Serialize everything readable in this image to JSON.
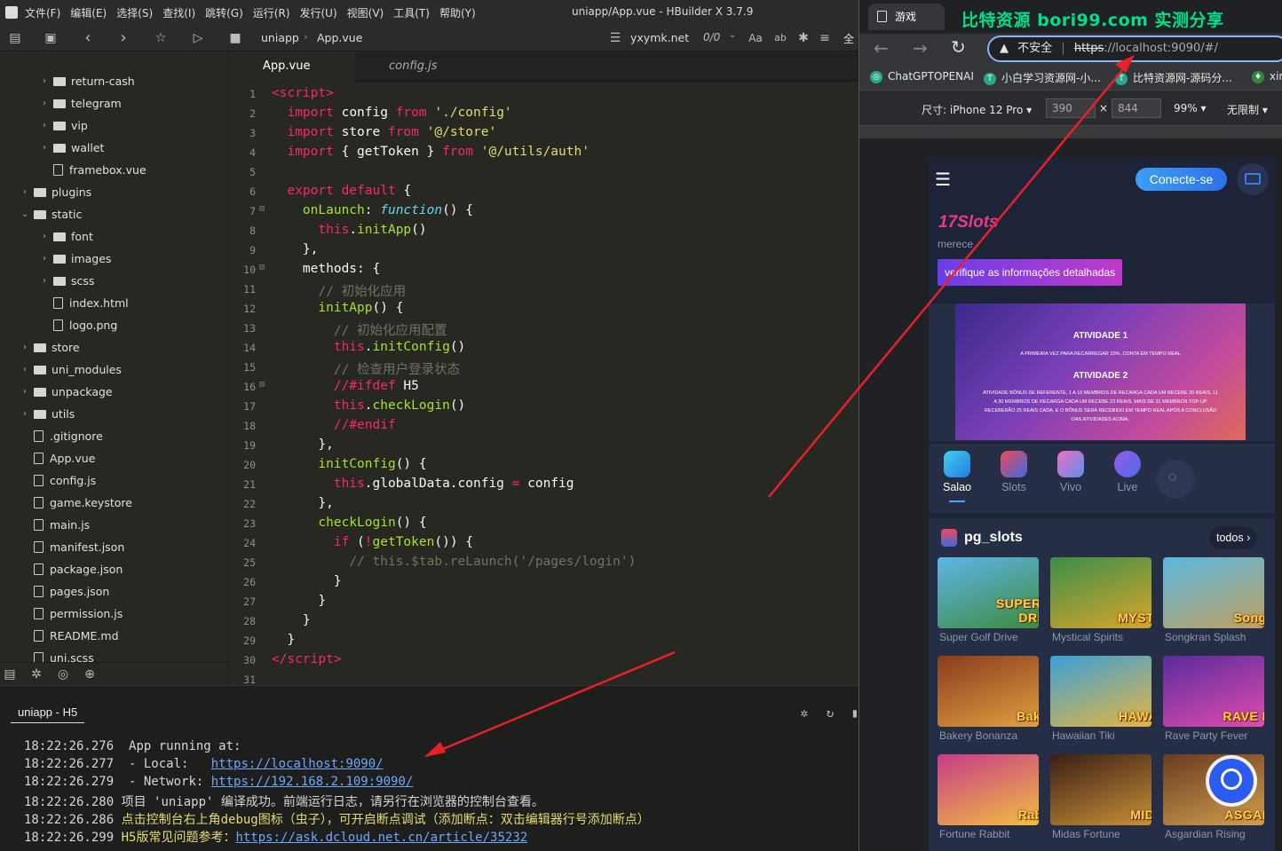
{
  "ide": {
    "menu": [
      "文件(F)",
      "编辑(E)",
      "选择(S)",
      "查找(I)",
      "跳转(G)",
      "运行(R)",
      "发行(U)",
      "视图(V)",
      "工具(T)",
      "帮助(Y)"
    ],
    "window_title": "uniapp/App.vue - HBuilder X 3.7.9",
    "breadcrumb": [
      "uniapp",
      "App.vue"
    ],
    "search_value": "yxymk.net",
    "match_count": "0/0",
    "toolbar_trailing": "全",
    "tree": [
      {
        "label": "return-cash",
        "type": "folder",
        "depth": 2
      },
      {
        "label": "telegram",
        "type": "folder",
        "depth": 2
      },
      {
        "label": "vip",
        "type": "folder",
        "depth": 2
      },
      {
        "label": "wallet",
        "type": "folder",
        "depth": 2
      },
      {
        "label": "framebox.vue",
        "type": "file",
        "depth": 2
      },
      {
        "label": "plugins",
        "type": "folder",
        "depth": 1
      },
      {
        "label": "static",
        "type": "folder-open",
        "depth": 1
      },
      {
        "label": "font",
        "type": "folder",
        "depth": 2
      },
      {
        "label": "images",
        "type": "folder",
        "depth": 2
      },
      {
        "label": "scss",
        "type": "folder",
        "depth": 2
      },
      {
        "label": "index.html",
        "type": "file",
        "depth": 2
      },
      {
        "label": "logo.png",
        "type": "file",
        "depth": 2
      },
      {
        "label": "store",
        "type": "folder",
        "depth": 1
      },
      {
        "label": "uni_modules",
        "type": "folder",
        "depth": 1
      },
      {
        "label": "unpackage",
        "type": "folder",
        "depth": 1
      },
      {
        "label": "utils",
        "type": "folder",
        "depth": 1
      },
      {
        "label": ".gitignore",
        "type": "file",
        "depth": 1
      },
      {
        "label": "App.vue",
        "type": "file",
        "depth": 1
      },
      {
        "label": "config.js",
        "type": "file",
        "depth": 1
      },
      {
        "label": "game.keystore",
        "type": "file",
        "depth": 1
      },
      {
        "label": "main.js",
        "type": "file",
        "depth": 1
      },
      {
        "label": "manifest.json",
        "type": "file",
        "depth": 1
      },
      {
        "label": "package.json",
        "type": "file",
        "depth": 1
      },
      {
        "label": "pages.json",
        "type": "file",
        "depth": 1
      },
      {
        "label": "permission.js",
        "type": "file",
        "depth": 1
      },
      {
        "label": "README.md",
        "type": "file",
        "depth": 1
      },
      {
        "label": "uni.scss",
        "type": "file",
        "depth": 1
      }
    ],
    "tabs": [
      "App.vue",
      "config.js"
    ],
    "console_tab": "uniapp - H5",
    "console": [
      {
        "time": "18:22:26.276",
        "text": "  App running at:"
      },
      {
        "time": "18:22:26.277",
        "text": "  - Local:   ",
        "link": "https://localhost:9090/"
      },
      {
        "time": "18:22:26.279",
        "text": "  - Network: ",
        "link": "https://192.168.2.109:9090/"
      },
      {
        "time": "18:22:26.280",
        "text": " 项目 'uniapp' 编译成功。前端运行日志，请另行在浏览器的控制台查看。"
      },
      {
        "time": "18:22:26.286",
        "text": " 点击控制台右上角debug图标（虫子），可开启断点调试（添加断点：双击编辑器行号添加断点）",
        "warn": true
      },
      {
        "time": "18:22:26.299",
        "text": " H5版常见问题参考：",
        "link": "https://ask.dcloud.net.cn/article/35232",
        "warn": true
      }
    ]
  },
  "browser": {
    "tab_title": "游戏",
    "watermark": "比特资源 bori99.com 实测分享",
    "security": "不安全",
    "url_scheme": "https",
    "url_rest": "://localhost:9090/#/",
    "bookmarks": [
      "ChatGPTOPENAI",
      "小白学习资源网-小...",
      "比特资源网-源码分...",
      "xir"
    ],
    "device_label": "尺寸: iPhone 12 Pro",
    "width": "390",
    "height": "844",
    "zoom": "99%",
    "throttle": "无限制"
  },
  "app": {
    "login_button": "Conecte-se",
    "promo_title": "17Slots",
    "promo_subtitle": "merece",
    "promo_button": "verifique as informações detalhadas",
    "banner_h1": "ATIVIDADE 1",
    "banner_t1": "A PRIMEIRA VEZ PARA RECARREGAR 10%, CONTA EM TEMPO REAL",
    "banner_h2": "ATIVIDADE 2",
    "banner_t2": "ATIVIDADE BÔNUS DE REFERENTE, 1 A 10 MEMBROS DE RECARGA CADA UM RECEBE 20 REAIS, 11 A 30 MEMBROS DE RECARGA CADA UM RECEBE 22 REAIS. MAIS DE 31 MEMBROS TOP-UP RECEBERÃO 25 REAIS CADA, E O BÔNUS SERÁ RECEBIDO EM TEMPO REAL APÓS A CONCLUSÃO DAS ATIVIDADES ACIMA.",
    "categories": [
      "Salao",
      "Slots",
      "Vivo",
      "Live"
    ],
    "section_title": "pg_slots",
    "section_more": "todos",
    "games": [
      {
        "name": "Super Golf Drive",
        "art": "SUPER GOLF DRIVE",
        "c1": "#5fb4e8",
        "c2": "#3d8c3f"
      },
      {
        "name": "Mystical Spirits",
        "art": "MYSTICAL",
        "c1": "#3b8e4a",
        "c2": "#d9a62a"
      },
      {
        "name": "Songkran Splash",
        "art": "Songkran",
        "c1": "#5ab8e0",
        "c2": "#c0a060"
      },
      {
        "name": "Bakery Bonanza",
        "art": "Bakery",
        "c1": "#8a3b1e",
        "c2": "#e0a040"
      },
      {
        "name": "Hawaiian Tiki",
        "art": "HAWAIIAN",
        "c1": "#3aa0d8",
        "c2": "#e6b640"
      },
      {
        "name": "Rave Party Fever",
        "art": "RAVE PARTY",
        "c1": "#5a2b9c",
        "c2": "#e04cb0"
      },
      {
        "name": "Fortune Rabbit",
        "art": "Rabbit",
        "c1": "#c83a8a",
        "c2": "#f0c040"
      },
      {
        "name": "Midas Fortune",
        "art": "MIDAS",
        "c1": "#3a1e14",
        "c2": "#c8903a"
      },
      {
        "name": "Asgardian Rising",
        "art": "ASGARDIAN",
        "c1": "#6a3a20",
        "c2": "#d0a050"
      }
    ]
  },
  "colors": {
    "ide_bg": "#272822",
    "keyword": "#f92672",
    "string": "#e6db74",
    "function": "#a6e22e",
    "comment": "#75715e",
    "link": "#6ca8ff",
    "arrow": "#e8202a",
    "app_bg": "#1d2438",
    "accent_blue": "#3a7bf0"
  }
}
